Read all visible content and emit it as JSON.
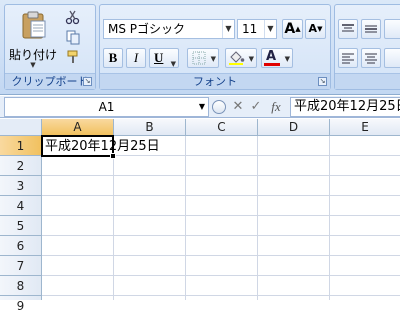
{
  "clipboard": {
    "paste_label": "貼り付け",
    "group_label": "クリップボード"
  },
  "font": {
    "name": "MS Pゴシック",
    "size": "11",
    "bold_label": "B",
    "italic_label": "I",
    "underline_label": "U",
    "grow_label": "A",
    "shrink_label": "A",
    "font_color_label": "A",
    "font_color": "#e00000",
    "group_label": "フォント"
  },
  "formula_bar": {
    "name_box": "A1",
    "fx_label": "fx",
    "content": "平成20年12月25日"
  },
  "grid": {
    "columns": [
      "A",
      "B",
      "C",
      "D",
      "E"
    ],
    "rows": [
      "1",
      "2",
      "3",
      "4",
      "5",
      "6",
      "7",
      "8",
      "9"
    ],
    "active_cell": "A1",
    "a1_value": "平成20年12月25日"
  },
  "icons": {
    "paste": "clipboard-icon",
    "cut": "scissors-icon",
    "copy": "copy-icon",
    "format_painter": "brush-icon",
    "cancel": "x-icon",
    "enter": "check-icon"
  }
}
